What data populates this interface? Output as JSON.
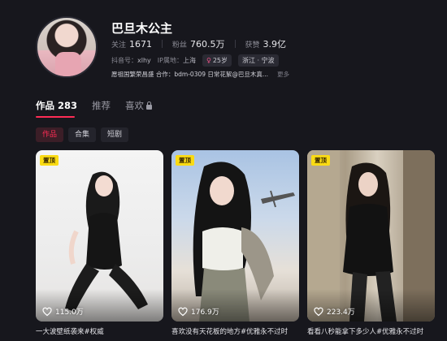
{
  "profile": {
    "name": "巴旦木公主",
    "stats": [
      {
        "label": "关注",
        "value": "1671"
      },
      {
        "label": "粉丝",
        "value": "760.5万"
      },
      {
        "label": "获赞",
        "value": "3.9亿"
      }
    ],
    "meta": {
      "id_label": "抖音号：",
      "id_value": "xlhy",
      "ip_label": "IP属地：",
      "ip_value": "上海",
      "age_symbol": "♀",
      "age": "25岁",
      "location": "浙江 · 宁波"
    },
    "bio": "愿祖国繁荣昌盛 合作：bdm-0309 日常花絮@巴旦木真...",
    "bio_more": "更多"
  },
  "tabs": [
    {
      "label": "作品 283",
      "active": true
    },
    {
      "label": "推荐",
      "active": false
    },
    {
      "label": "喜欢",
      "active": false
    }
  ],
  "subtabs": [
    {
      "label": "作品",
      "active": true
    },
    {
      "label": "合集",
      "active": false
    },
    {
      "label": "短剧",
      "active": false
    }
  ],
  "videos": [
    {
      "pin": "置顶",
      "likes": "115.0万",
      "caption": "一大波壁纸袭来#权威"
    },
    {
      "pin": "置顶",
      "likes": "176.9万",
      "caption": "喜欢没有天花板的地方#优雅永不过时"
    },
    {
      "pin": "置顶",
      "likes": "223.4万",
      "caption": "看看八秒能拿下多少人#优雅永不过时"
    }
  ],
  "colors": {
    "accent": "#fe2c55",
    "pin": "#fadb14",
    "background": "#17171d"
  }
}
